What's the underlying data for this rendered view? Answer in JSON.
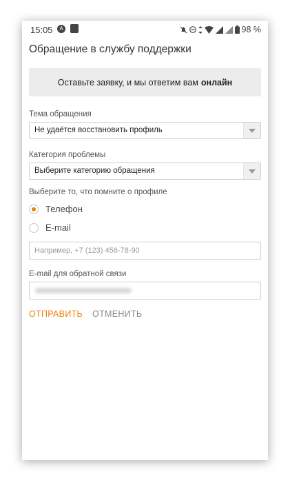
{
  "status_bar": {
    "time": "15:05",
    "battery": "98 %"
  },
  "page": {
    "title": "Обращение в службу поддержки"
  },
  "banner": {
    "text": "Оставьте заявку, и мы ответим вам",
    "emphasis": "онлайн"
  },
  "form": {
    "topic": {
      "label": "Тема обращения",
      "value": "Не удаётся восстановить профиль"
    },
    "category": {
      "label": "Категория проблемы",
      "value": "Выберите категорию обращения"
    },
    "remember": {
      "label": "Выберите то, что помните о профиле",
      "options": [
        {
          "label": "Телефон",
          "checked": true
        },
        {
          "label": "E-mail",
          "checked": false
        }
      ]
    },
    "phone_input": {
      "placeholder": "Например, +7 (123) 456-78-90"
    },
    "email": {
      "label": "E-mail для обратной связи"
    }
  },
  "actions": {
    "submit": "ОТПРАВИТЬ",
    "cancel": "ОТМЕНИТЬ"
  },
  "colors": {
    "accent": "#ee8208",
    "banner_bg": "#ececec"
  }
}
